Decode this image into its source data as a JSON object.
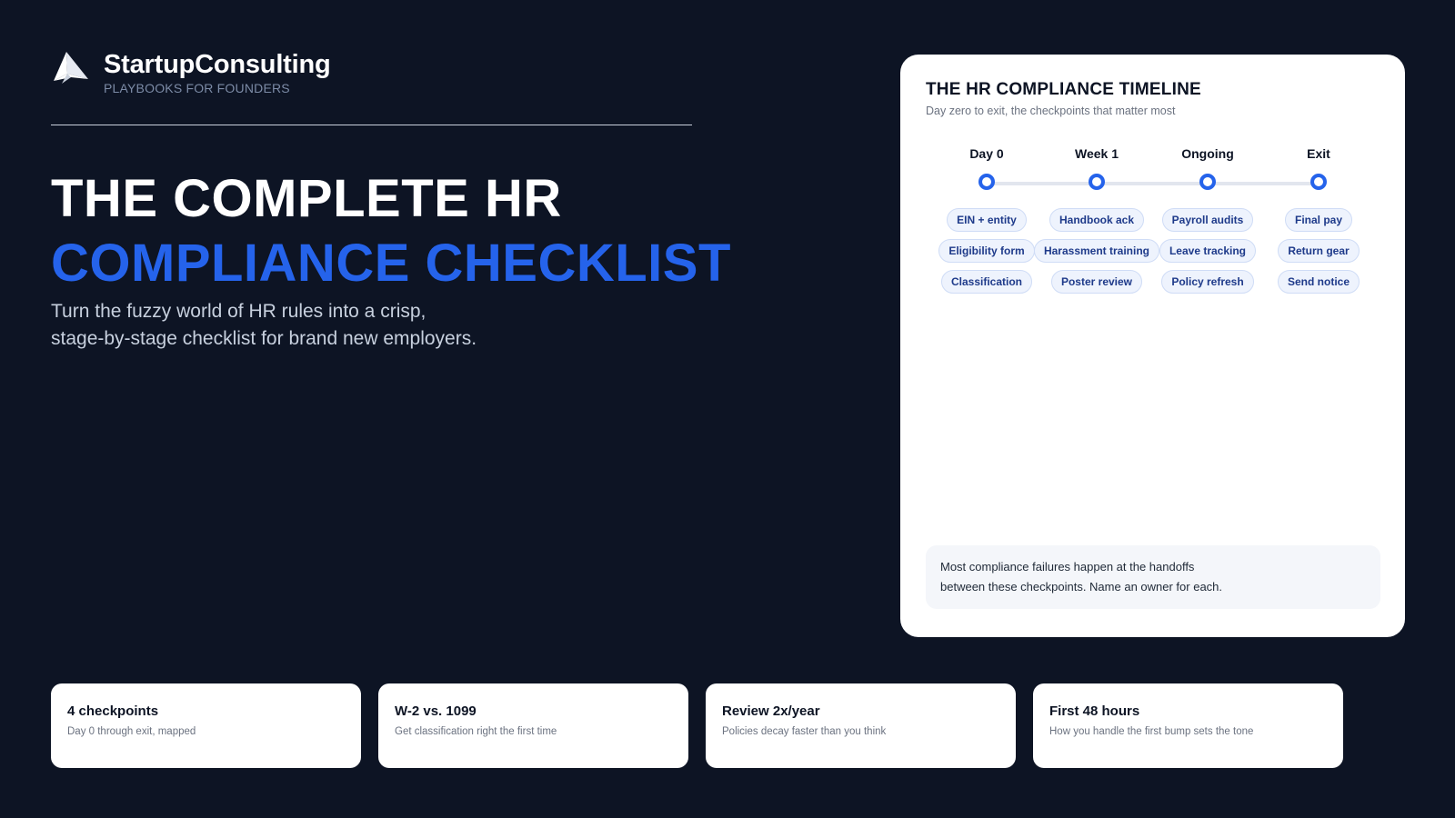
{
  "brand": {
    "name": "StartupConsulting",
    "tagline": "PLAYBOOKS FOR FOUNDERS",
    "logo_icon": "paper-plane-icon"
  },
  "hero": {
    "title_line1": "THE COMPLETE HR",
    "title_line2": "COMPLIANCE CHECKLIST",
    "subtitle_line1": "Turn the fuzzy world of HR rules into a crisp,",
    "subtitle_line2": "stage-by-stage checklist for brand new employers.",
    "accent_color": "#2563eb"
  },
  "timeline_card": {
    "title": "THE HR COMPLIANCE TIMELINE",
    "subtitle": "Day zero to exit, the checkpoints that matter most",
    "stages": [
      {
        "label": "Day 0",
        "items": [
          "EIN + entity",
          "Eligibility form",
          "Classification"
        ]
      },
      {
        "label": "Week 1",
        "items": [
          "Handbook ack",
          "Harassment training",
          "Poster review"
        ]
      },
      {
        "label": "Ongoing",
        "items": [
          "Payroll audits",
          "Leave tracking",
          "Policy refresh"
        ]
      },
      {
        "label": "Exit",
        "items": [
          "Final pay",
          "Return gear",
          "Send notice"
        ]
      }
    ],
    "note_line1": "Most compliance failures happen at the handoffs",
    "note_line2": "between these checkpoints. Name an owner for each."
  },
  "stats": [
    {
      "title": "4 checkpoints",
      "desc": "Day 0 through exit, mapped"
    },
    {
      "title": "W-2 vs. 1099",
      "desc": "Get classification right the first time"
    },
    {
      "title": "Review 2x/year",
      "desc": "Policies decay faster than you think"
    },
    {
      "title": "First 48 hours",
      "desc": "How you handle the first bump sets the tone"
    }
  ]
}
